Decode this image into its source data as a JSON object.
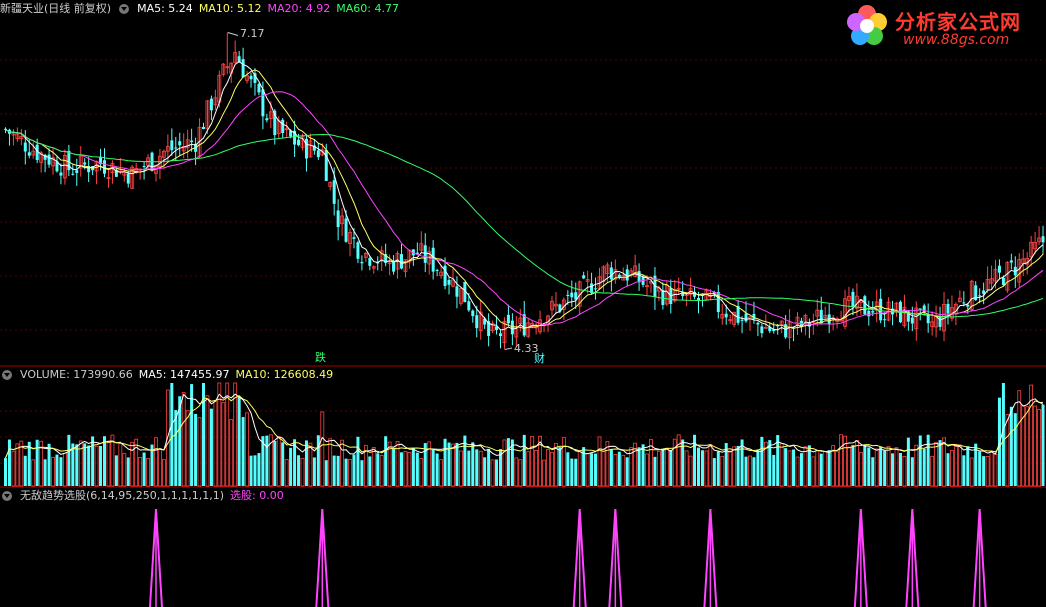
{
  "main_panel": {
    "title": "新疆天业(日线 前复权)",
    "indicators": [
      {
        "label": "MA5: 5.24",
        "color": "#ffffff"
      },
      {
        "label": "MA10: 5.12",
        "color": "#ffff66"
      },
      {
        "label": "MA20: 4.92",
        "color": "#ff44ff"
      },
      {
        "label": "MA60: 4.77",
        "color": "#33ff66"
      }
    ],
    "high_annotation": "7.17",
    "low_annotation": "4.33",
    "marker_die": "跌",
    "marker_cai": "财"
  },
  "volume_panel": {
    "indicators": [
      {
        "label": "VOLUME: 173990.66",
        "color": "#cccccc"
      },
      {
        "label": "MA5: 147455.97",
        "color": "#ffffff"
      },
      {
        "label": "MA10: 126608.49",
        "color": "#ffff66"
      }
    ]
  },
  "signal_panel": {
    "title": "无敌趋势选股(6,14,95,250,1,1,1,1,1,1)",
    "value_label": "选股: 0.00",
    "value_color": "#ff44ff"
  },
  "logo": {
    "name": "分析家公式网",
    "url": "www.88gs.com"
  },
  "colors": {
    "up": "#ff4444",
    "down": "#55ffff",
    "ma5": "#ffffff",
    "ma10": "#ffff66",
    "ma20": "#ff44ff",
    "ma60": "#33ff66",
    "signal": "#ff44ff",
    "grid": "#550000"
  },
  "chart_data": {
    "type": "candlestick",
    "price_ylim": [
      4.2,
      7.3
    ],
    "price_keypoints": [
      [
        0,
        6.3
      ],
      [
        8,
        6.1
      ],
      [
        16,
        5.95
      ],
      [
        24,
        6.0
      ],
      [
        32,
        5.9
      ],
      [
        40,
        6.1
      ],
      [
        48,
        6.2
      ],
      [
        55,
        6.8
      ],
      [
        58,
        7.0
      ],
      [
        62,
        6.7
      ],
      [
        68,
        6.3
      ],
      [
        75,
        6.15
      ],
      [
        80,
        6.1
      ],
      [
        84,
        5.5
      ],
      [
        90,
        5.2
      ],
      [
        97,
        5.1
      ],
      [
        104,
        5.2
      ],
      [
        110,
        5.05
      ],
      [
        116,
        4.8
      ],
      [
        122,
        4.45
      ],
      [
        128,
        4.5
      ],
      [
        136,
        4.65
      ],
      [
        144,
        4.8
      ],
      [
        152,
        5.05
      ],
      [
        158,
        5.0
      ],
      [
        164,
        4.85
      ],
      [
        170,
        4.8
      ],
      [
        178,
        4.75
      ],
      [
        186,
        4.6
      ],
      [
        194,
        4.5
      ],
      [
        202,
        4.55
      ],
      [
        210,
        4.7
      ],
      [
        218,
        4.7
      ],
      [
        226,
        4.65
      ],
      [
        234,
        4.55
      ],
      [
        242,
        4.8
      ],
      [
        250,
        4.95
      ],
      [
        258,
        5.15
      ],
      [
        262,
        5.3
      ]
    ],
    "signal_indices": [
      38,
      80,
      145,
      154,
      178,
      216,
      229,
      246
    ]
  }
}
